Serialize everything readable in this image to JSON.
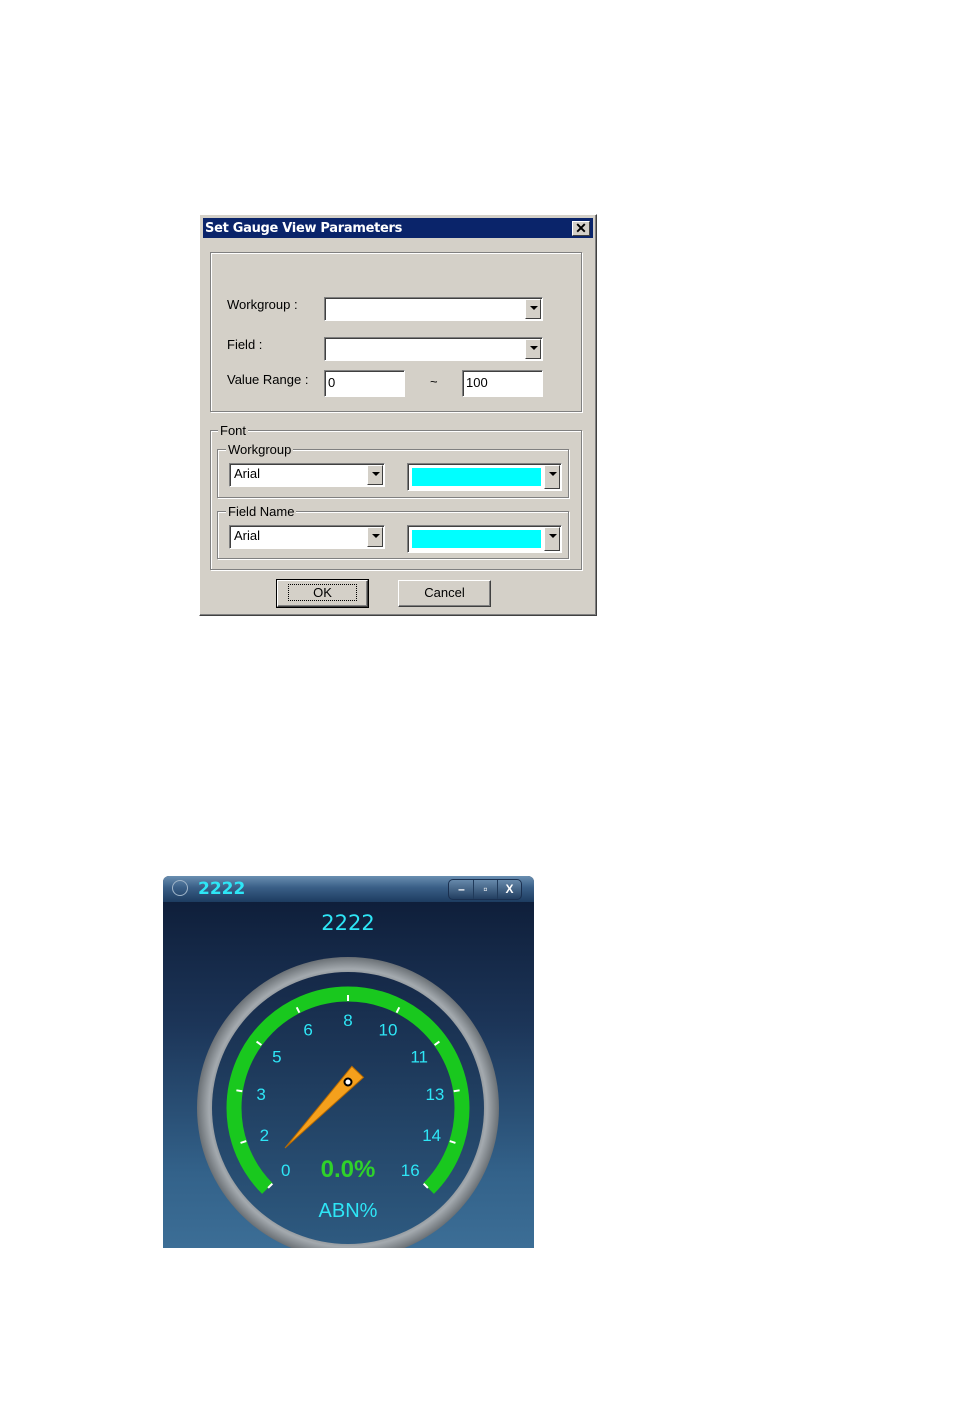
{
  "dialog": {
    "title": "Set Gauge View Parameters",
    "close_symbol": "✕",
    "workgroup_label": "Workgroup :",
    "workgroup_value": "",
    "field_label": "Field :",
    "field_value": "",
    "value_range_label": "Value Range :",
    "range_min": "0",
    "range_separator": "~",
    "range_max": "100",
    "font_group_label": "Font",
    "font_workgroup_label": "Workgroup",
    "font_workgroup_face": "Arial",
    "font_workgroup_color": "#00ffff",
    "font_fieldname_label": "Field Name",
    "font_fieldname_face": "Arial",
    "font_fieldname_color": "#00ffff",
    "ok_label": "OK",
    "cancel_label": "Cancel"
  },
  "gauge_window": {
    "title": "2222",
    "controls": {
      "minimize": "–",
      "maximize": "▫",
      "close": "X"
    },
    "heading": "2222",
    "scale_labels": [
      "0",
      "2",
      "3",
      "5",
      "6",
      "8",
      "10",
      "11",
      "13",
      "14",
      "16"
    ],
    "value_text": "0.0%",
    "unit_text": "ABN%",
    "colors": {
      "arc": "#19c81e",
      "label": "#2ee6f6",
      "needle": "#f5a01c",
      "value": "#2fd22a"
    }
  }
}
